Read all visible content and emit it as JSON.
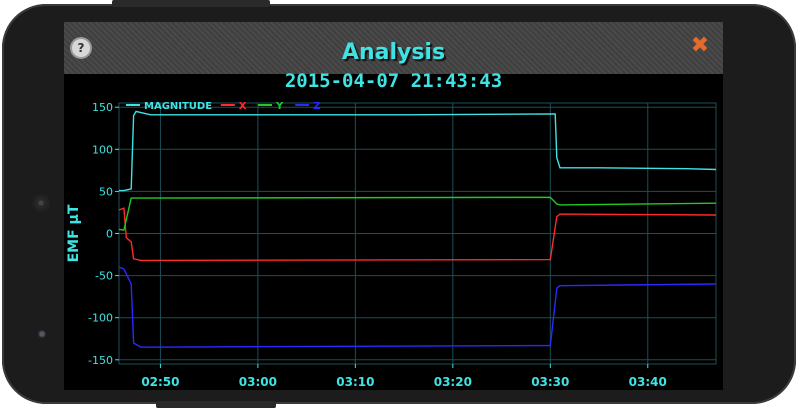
{
  "app": {
    "title": "Analysis",
    "datetime": "2015-04-07 21:43:43",
    "help_label": "?",
    "close_label": "✖"
  },
  "colors": {
    "accent": "#3fe3e3",
    "grid": "#1c4f58",
    "magnitude": "#3fe3e3",
    "x": "#ff2a2a",
    "y": "#22c922",
    "z": "#2a2aff",
    "close": "#e36b2c"
  },
  "chart_data": {
    "type": "line",
    "title": "",
    "xlabel": "",
    "ylabel": "EMF µT",
    "ylim": [
      -155,
      155
    ],
    "xlim": [
      "02:45:45",
      "03:47:00"
    ],
    "grid": true,
    "legend_position": "top-left",
    "yticks": [
      150,
      100,
      50,
      0,
      -50,
      -100,
      -150
    ],
    "xticks": [
      "02:50",
      "03:00",
      "03:10",
      "03:20",
      "03:30",
      "03:40"
    ],
    "series": [
      {
        "name": "MAGNITUDE",
        "color": "#3fe3e3",
        "points": [
          [
            "02:45:45",
            51
          ],
          [
            "02:46:15",
            51
          ],
          [
            "02:47:00",
            53
          ],
          [
            "02:47:15",
            140
          ],
          [
            "02:47:30",
            145
          ],
          [
            "02:49:00",
            141
          ],
          [
            "03:15:00",
            141
          ],
          [
            "03:30:30",
            142
          ],
          [
            "03:30:40",
            90
          ],
          [
            "03:31:00",
            78
          ],
          [
            "03:35:00",
            78
          ],
          [
            "03:44:00",
            77
          ],
          [
            "03:47:00",
            76
          ]
        ]
      },
      {
        "name": "X",
        "color": "#ff2a2a",
        "points": [
          [
            "02:45:45",
            28
          ],
          [
            "02:46:15",
            30
          ],
          [
            "02:46:30",
            -5
          ],
          [
            "02:47:00",
            -10
          ],
          [
            "02:47:15",
            -30
          ],
          [
            "02:48:00",
            -32
          ],
          [
            "03:30:00",
            -31
          ],
          [
            "03:30:40",
            20
          ],
          [
            "03:31:00",
            23
          ],
          [
            "03:47:00",
            22
          ]
        ]
      },
      {
        "name": "Y",
        "color": "#22c922",
        "points": [
          [
            "02:45:45",
            5
          ],
          [
            "02:46:15",
            4
          ],
          [
            "02:47:00",
            42
          ],
          [
            "03:30:00",
            43
          ],
          [
            "03:30:40",
            35
          ],
          [
            "03:31:00",
            34
          ],
          [
            "03:47:00",
            36
          ]
        ]
      },
      {
        "name": "Z",
        "color": "#2a2aff",
        "points": [
          [
            "02:45:45",
            -40
          ],
          [
            "02:46:15",
            -42
          ],
          [
            "02:47:00",
            -60
          ],
          [
            "02:47:15",
            -130
          ],
          [
            "02:48:00",
            -135
          ],
          [
            "03:30:00",
            -133
          ],
          [
            "03:30:40",
            -65
          ],
          [
            "03:31:00",
            -62
          ],
          [
            "03:47:00",
            -60
          ]
        ]
      }
    ]
  }
}
